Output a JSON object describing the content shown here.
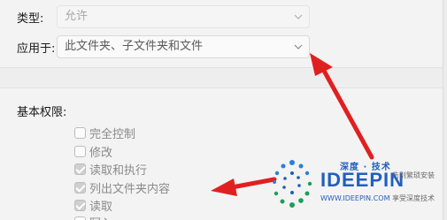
{
  "type_row": {
    "label": "类型:",
    "value": "允许"
  },
  "applies_row": {
    "label": "应用于:",
    "value": "此文件夹、子文件夹和文件"
  },
  "basic_permissions": {
    "heading": "基本权限:",
    "items": [
      {
        "label": "完全控制",
        "checked": false
      },
      {
        "label": "修改",
        "checked": false
      },
      {
        "label": "读取和执行",
        "checked": true
      },
      {
        "label": "列出文件夹内容",
        "checked": true
      },
      {
        "label": "读取",
        "checked": true
      },
      {
        "label": "写入",
        "checked": false
      }
    ]
  },
  "icons": {
    "dropdown": "chevron-down-icon"
  },
  "colors": {
    "arrow": "#e02020",
    "brand": "#1f5fbf"
  },
  "watermark": {
    "title": "深度 · 技术",
    "brand": "IDEEPIN",
    "url": "WWW.IDEEPIN.COM",
    "slogan1": "告别繁琐安装",
    "slogan2": "享受深度技术"
  }
}
